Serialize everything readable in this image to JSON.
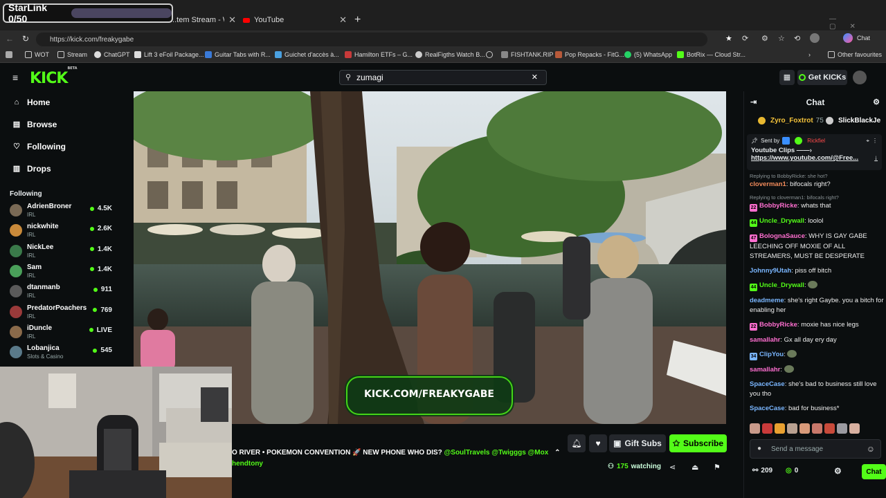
{
  "overlay": {
    "starlink_label": "StarLink 0/50"
  },
  "browser": {
    "tabs": [
      {
        "label": "...tem Stream - Watch L"
      },
      {
        "label": "YouTube"
      }
    ],
    "new_tab": "+",
    "url": "https://kick.com/freakygabe",
    "address_right_label": "Chat",
    "bookmarks": [
      "WOT",
      "Stream",
      "ChatGPT",
      "Lift 3 eFoil Package...",
      "Guitar Tabs with R...",
      "Guichet d'accès à...",
      "Hamilton ETFs – G...",
      "RealFigths Watch B...",
      "",
      "FISHTANK.RIP",
      "Pop Repacks - FitG...",
      "(5) WhatsApp",
      "BotRix — Cloud Str..."
    ],
    "other_favourites": "Other favourites"
  },
  "kick": {
    "logo": "KICK",
    "logo_beta": "BETA",
    "search_value": "zumagi",
    "get_kicks": "Get KICKs"
  },
  "sidebar": {
    "nav": [
      {
        "label": "Home",
        "icon": "home-icon"
      },
      {
        "label": "Browse",
        "icon": "browse-icon"
      },
      {
        "label": "Following",
        "icon": "heart-icon"
      },
      {
        "label": "Drops",
        "icon": "drops-icon"
      }
    ],
    "following_header": "Following",
    "following": [
      {
        "name": "AdrienBroner",
        "category": "IRL",
        "viewers": "4.5K",
        "color": "#7a6a55"
      },
      {
        "name": "nickwhite",
        "category": "IRL",
        "viewers": "2.6K",
        "color": "#c98a3a"
      },
      {
        "name": "NickLee",
        "category": "IRL",
        "viewers": "1.4K",
        "color": "#3a7a4a"
      },
      {
        "name": "Sam",
        "category": "IRL",
        "viewers": "1.4K",
        "color": "#4aa05a"
      },
      {
        "name": "dtanmanb",
        "category": "IRL",
        "viewers": "911",
        "color": "#5a5a5a"
      },
      {
        "name": "PredatorPoachers",
        "category": "IRL",
        "viewers": "769",
        "color": "#9a3a3a"
      },
      {
        "name": "iDuncle",
        "category": "IRL",
        "viewers": "LIVE",
        "color": "#8a6a4a"
      },
      {
        "name": "Lobanjica",
        "category": "Slots & Casino",
        "viewers": "545",
        "color": "#5a7a8a"
      }
    ]
  },
  "video": {
    "watermark": "KICK.COM/FREAKYGABE"
  },
  "stream": {
    "title_prefix": "O RIVER • POKEMON CONVENTION 🚀 NEW PHONE WHO DIS? ",
    "title_tags": "@SoulTravels @Twigggs @Mox",
    "collab": "hendtony",
    "gift_subs": "Gift Subs",
    "subscribe": "Subscribe",
    "watching_count": "175",
    "watching_label": "watching"
  },
  "chat": {
    "header": "Chat",
    "gifters": [
      {
        "name": "Zyro_Foxtrot",
        "count": "75"
      },
      {
        "name": "SlickBlackJe",
        "count": ""
      }
    ],
    "pinned": {
      "sent_by": "Sent by",
      "author": "Rickfiel",
      "line1": "Youtube Clips ——›",
      "link": "https://www.youtube.com/@Free..."
    },
    "messages": [
      {
        "reply": "Replying to BobbyRicke: she hot?",
        "user": "cloverman1",
        "color": "#f08a5a",
        "badge": "",
        "text": "bifocals right?"
      },
      {
        "reply": "Replying to cloverman1: bifocals right?",
        "user": "BobbyRicke",
        "color": "#ff6fd0",
        "badge": "22",
        "text": "whats that"
      },
      {
        "reply": "",
        "user": "Uncle_Drywall",
        "color": "#53fc18",
        "badge": "44",
        "text": "loolol"
      },
      {
        "reply": "",
        "user": "BolognaSauce",
        "color": "#ff6fd0",
        "badge": "47",
        "text": "WHY IS GAY GABE LEECHING OFF MOXIE OF ALL STREAMERS, MUST BE DESPERATE"
      },
      {
        "reply": "",
        "user": "Johnny9Utah",
        "color": "#7ab6ff",
        "badge": "",
        "text": "piss off bitch"
      },
      {
        "reply": "",
        "user": "Uncle_Drywall",
        "color": "#53fc18",
        "badge": "44",
        "text": ""
      },
      {
        "reply": "",
        "user": "deadmeme",
        "color": "#7ab6ff",
        "badge": "",
        "text": "she's right Gaybe. you a bitch for enabling her"
      },
      {
        "reply": "",
        "user": "BobbyRicke",
        "color": "#ff6fd0",
        "badge": "22",
        "text": "moxie has nice legs"
      },
      {
        "reply": "",
        "user": "samallahr",
        "color": "#ff6fd0",
        "badge": "",
        "text": "Gx all day ery day"
      },
      {
        "reply": "",
        "user": "ClipYou",
        "color": "#7ab6ff",
        "badge": "34",
        "text": ""
      },
      {
        "reply": "",
        "user": "samallahr",
        "color": "#ff6fd0",
        "badge": "",
        "text": ""
      },
      {
        "reply": "",
        "user": "SpaceCase",
        "color": "#7ab6ff",
        "badge": "",
        "text": "she's bad to business still love you tho"
      },
      {
        "reply": "",
        "user": "SpaceCase",
        "color": "#7ab6ff",
        "badge": "",
        "text": "bad for business*"
      }
    ],
    "input_placeholder": "Send a message",
    "stat_a": "209",
    "stat_b": "0",
    "send_button": "Chat"
  },
  "colors": {
    "accent": "#53fc18",
    "bg": "#0b0e0f",
    "panel": "#24272c"
  }
}
